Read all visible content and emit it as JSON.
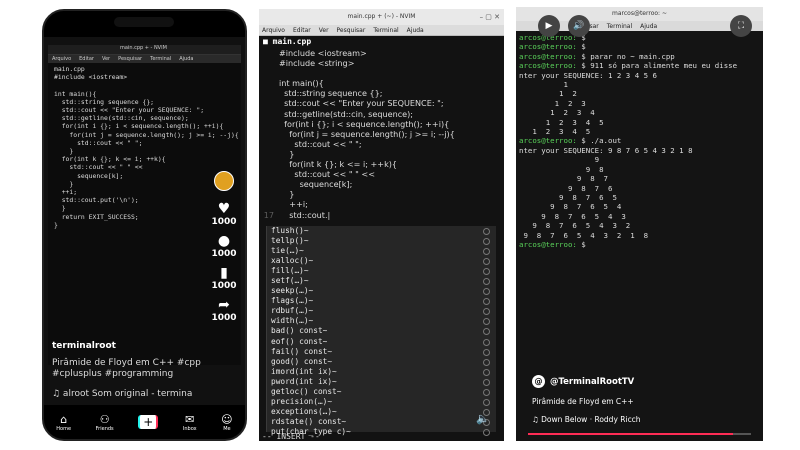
{
  "phone": {
    "window_title": "main.cpp + - NVIM",
    "menu": [
      "Arquivo",
      "Editar",
      "Ver",
      "Pesquisar",
      "Terminal",
      "Ajuda"
    ],
    "code_lines": [
      "main.cpp",
      "#include <iostream>",
      "",
      "int main(){",
      "  std::string sequence {};",
      "  std::cout << \"Enter your SEQUENCE: \";",
      "  std::getline(std::cin, sequence);",
      "  for(int i {}; i < sequence.length(); ++i){",
      "    for(int j = sequence.length(); j >= i; --j){",
      "      std::cout << \" \";",
      "    }",
      "  for(int k {}; k <= i; ++k){",
      "    std::cout << \" \" <<",
      "      sequence[k];",
      "    }",
      "  ++i;",
      "  std::cout.put('\\n');",
      "  }",
      "  return EXIT_SUCCESS;",
      "}"
    ],
    "likes": "1000",
    "comments": "1000",
    "saves": "1000",
    "shares": "1000",
    "username": "terminalroot",
    "description": "Pirâmide de Floyd em C++ #cpp #cplusplus #programming",
    "sound": "♫ alroot    Som original - termina",
    "nav": [
      "Home",
      "Friends",
      "",
      "Inbox",
      "Me"
    ]
  },
  "nvim": {
    "window_title": "main.cpp + (~) - NVIM",
    "menu": [
      "Arquivo",
      "Editar",
      "Ver",
      "Pesquisar",
      "Terminal",
      "Ajuda"
    ],
    "tab": "main.cpp",
    "code": [
      {
        "n": "",
        "text": "#include <iostream>"
      },
      {
        "n": "",
        "text": "#include <string>"
      },
      {
        "n": "",
        "text": ""
      },
      {
        "n": "",
        "text": "int main(){"
      },
      {
        "n": "",
        "text": "  std::string sequence {};"
      },
      {
        "n": "",
        "text": "  std::cout << \"Enter your SEQUENCE: \";"
      },
      {
        "n": "",
        "text": "  std::getline(std::cin, sequence);"
      },
      {
        "n": "",
        "text": "  for(int i {}; i < sequence.length(); ++i){"
      },
      {
        "n": "",
        "text": "    for(int j = sequence.length(); j >= i; --j){"
      },
      {
        "n": "",
        "text": "      std::cout << \" \";"
      },
      {
        "n": "",
        "text": "    }"
      },
      {
        "n": "",
        "text": "    for(int k {}; k <= i; ++k){"
      },
      {
        "n": "",
        "text": "      std::cout << \" \" <<"
      },
      {
        "n": "",
        "text": "        sequence[k];"
      },
      {
        "n": "",
        "text": "    }"
      },
      {
        "n": "",
        "text": "    ++i;"
      },
      {
        "n": "17",
        "text": "    std::cout.|"
      }
    ],
    "completions": [
      "flush()~",
      "tellp()~",
      "tie(…)~",
      "xalloc()~",
      "fill(…)~",
      "setf(…)~",
      "seekp(…)~",
      "flags(…)~",
      "rdbuf(…)~",
      "width(…)~",
      "bad() const~",
      "eof() const~",
      "fail() const~",
      "good() const~",
      "imord(int ix)~",
      "pword(int ix)~",
      "getloc() const~",
      "precision(…)~",
      "exceptions(…)~",
      "rdstate() const~",
      "put(char_type c)~"
    ],
    "mode": "-- INSERT --"
  },
  "terminal": {
    "window_title": "marcos@terroo: ~",
    "menu": [
      "Pesquisar",
      "Terminal",
      "Ajuda"
    ],
    "prompt": "arcos@terroo:",
    "lines": [
      {
        "p": "arcos@terroo:",
        "t": " $"
      },
      {
        "p": "arcos@terroo:",
        "t": " $"
      },
      {
        "p": "arcos@terroo:",
        "t": " $ parar no ~ main.cpp"
      },
      {
        "p": "arcos@terroo:",
        "t": " $ 911 só para alimente meu eu disse"
      },
      {
        "p": "",
        "t": "nter your SEQUENCE: 1 2 3 4 5 6"
      },
      {
        "p": "",
        "t": "          1"
      },
      {
        "p": "",
        "t": "         1  2"
      },
      {
        "p": "",
        "t": "        1  2  3"
      },
      {
        "p": "",
        "t": "       1  2  3  4"
      },
      {
        "p": "",
        "t": "      1  2  3  4  5"
      },
      {
        "p": "",
        "t": "   1  2  3  4  5"
      },
      {
        "p": "arcos@terroo:",
        "t": " $ ./a.out"
      },
      {
        "p": "",
        "t": "nter your SEQUENCE: 9 8 7 6 5 4 3 2 1 8"
      },
      {
        "p": "",
        "t": "                 9"
      },
      {
        "p": "",
        "t": "               9  8"
      },
      {
        "p": "",
        "t": "             9  8  7"
      },
      {
        "p": "",
        "t": "           9  8  7  6"
      },
      {
        "p": "",
        "t": "         9  8  7  6  5"
      },
      {
        "p": "",
        "t": "       9  8  7  6  5  4"
      },
      {
        "p": "",
        "t": "     9  8  7  6  5  4  3"
      },
      {
        "p": "",
        "t": "   9  8  7  6  5  4  3  2"
      },
      {
        "p": "",
        "t": " 9  8  7  6  5  4  3  2  1  8"
      },
      {
        "p": "arcos@terroo:",
        "t": " $"
      }
    ],
    "handle": "@TerminalRootTV",
    "description": "Pirâmide de Floyd em C++",
    "music": "♫ Down Below · Roddy Ricch",
    "progress": 0.92
  },
  "colors": {
    "keyword": "#ff4fa3",
    "prompt": "#5ad25a",
    "accent": "#fe2c55"
  }
}
